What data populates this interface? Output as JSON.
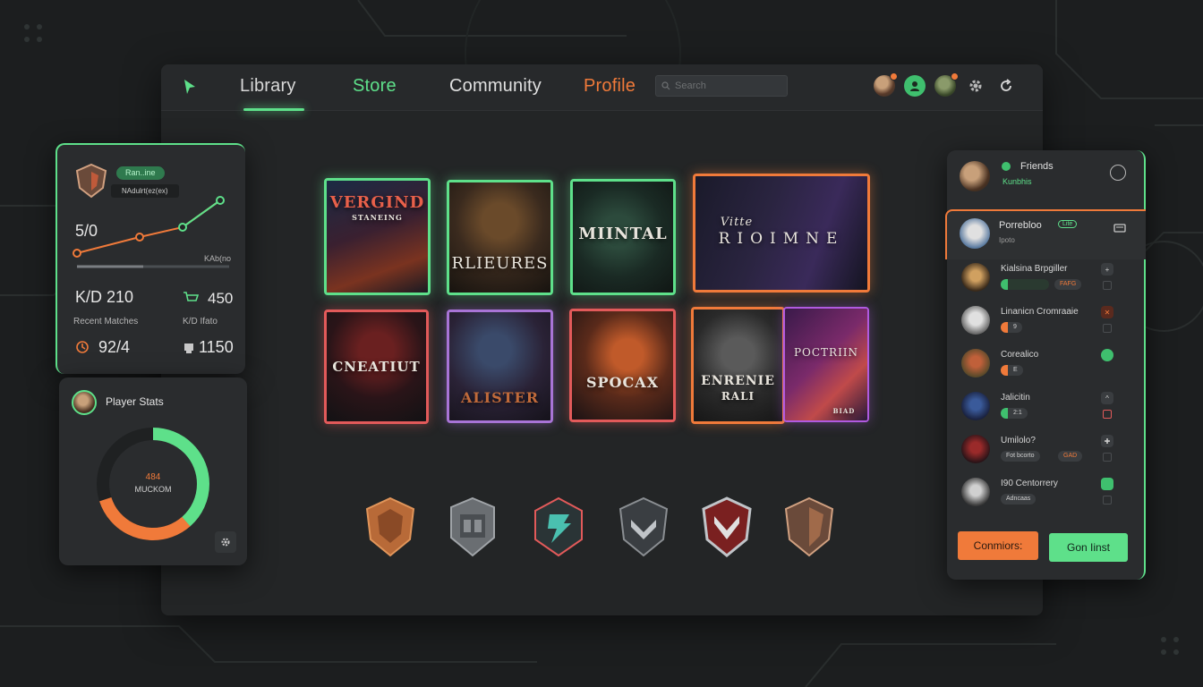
{
  "nav": {
    "library": "Library",
    "store": "Store",
    "community": "Community",
    "profile": "Profile",
    "search_placeholder": "Search"
  },
  "colors": {
    "accent_green": "#5ee08a",
    "accent_orange": "#f07a3a",
    "background": "#1c1e1f",
    "panel": "#2a2c2e"
  },
  "stats": {
    "rank_label": "Ran..ine",
    "rank_sub": "NAdulrt(ez(ex)",
    "score": "5/0",
    "chart_caption": "KAb(no",
    "kd": "K/D 210",
    "kd_value_right": "450",
    "recent_matches": "Recent Matches",
    "kd_ratio_label": "K/D Ifato",
    "matches_value": "92/4",
    "total_value": "1150"
  },
  "player_stats": {
    "title": "Player Stats",
    "ring_value": "484",
    "ring_label": "MUCKOM",
    "progress": 0.7
  },
  "games": [
    {
      "title": "VERGIND",
      "subtitle": "STANEING"
    },
    {
      "title": "RLIEURES",
      "subtitle": ""
    },
    {
      "title": "MIINTAL",
      "subtitle": ""
    },
    {
      "title": "RIOIMNE",
      "subtitle": "Vitte"
    },
    {
      "title": "CNEATIUT",
      "subtitle": ""
    },
    {
      "title": "ALISTER",
      "subtitle": ""
    },
    {
      "title": "SPOCAX",
      "subtitle": ""
    },
    {
      "title": "ENRENIE",
      "subtitle": "RALI"
    },
    {
      "title": "POCTRIIN",
      "subtitle": "BIAD"
    }
  ],
  "badges": [
    {
      "icon": "bronze-shield-badge-icon"
    },
    {
      "icon": "steel-helmet-badge-icon"
    },
    {
      "icon": "teal-emblem-badge-icon"
    },
    {
      "icon": "chevron-shield-badge-icon"
    },
    {
      "icon": "red-shield-badge-icon"
    },
    {
      "icon": "copper-shield-badge-icon"
    }
  ],
  "friends": {
    "title": "Friends",
    "subtitle": "Kunbhis",
    "featured": {
      "name": "Porrebloo",
      "status": "Lite",
      "sub": "Ipoto"
    },
    "list": [
      {
        "name": "Kialsina Brpgiller",
        "tag1": "",
        "tag2": "FAFG"
      },
      {
        "name": "Linanicn Cromraaie",
        "tag1": "9",
        "tag2": ""
      },
      {
        "name": "Corealico",
        "tag1": "E",
        "tag2": ""
      },
      {
        "name": "Jalicitin",
        "tag1": "2:1",
        "tag2": ""
      },
      {
        "name": "Umilolo?",
        "tag1": "Fot bcorto",
        "tag2": "GAD"
      },
      {
        "name": "I90 Centorrery",
        "tag1": "Adncaas",
        "tag2": ""
      }
    ],
    "btn_left": "Conmiors:",
    "btn_right": "Gon Iinst"
  }
}
